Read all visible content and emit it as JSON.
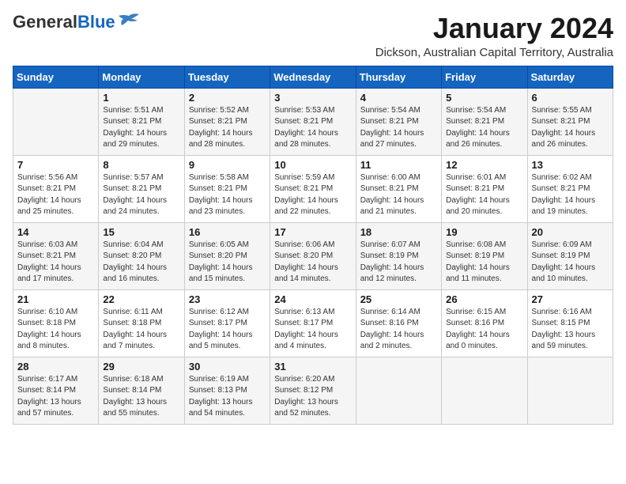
{
  "logo": {
    "general": "General",
    "blue": "Blue"
  },
  "header": {
    "month_year": "January 2024",
    "location": "Dickson, Australian Capital Territory, Australia"
  },
  "weekdays": [
    "Sunday",
    "Monday",
    "Tuesday",
    "Wednesday",
    "Thursday",
    "Friday",
    "Saturday"
  ],
  "weeks": [
    [
      {
        "day": "",
        "sunrise": "",
        "sunset": "",
        "daylight": ""
      },
      {
        "day": "1",
        "sunrise": "Sunrise: 5:51 AM",
        "sunset": "Sunset: 8:21 PM",
        "daylight": "Daylight: 14 hours and 29 minutes."
      },
      {
        "day": "2",
        "sunrise": "Sunrise: 5:52 AM",
        "sunset": "Sunset: 8:21 PM",
        "daylight": "Daylight: 14 hours and 28 minutes."
      },
      {
        "day": "3",
        "sunrise": "Sunrise: 5:53 AM",
        "sunset": "Sunset: 8:21 PM",
        "daylight": "Daylight: 14 hours and 28 minutes."
      },
      {
        "day": "4",
        "sunrise": "Sunrise: 5:54 AM",
        "sunset": "Sunset: 8:21 PM",
        "daylight": "Daylight: 14 hours and 27 minutes."
      },
      {
        "day": "5",
        "sunrise": "Sunrise: 5:54 AM",
        "sunset": "Sunset: 8:21 PM",
        "daylight": "Daylight: 14 hours and 26 minutes."
      },
      {
        "day": "6",
        "sunrise": "Sunrise: 5:55 AM",
        "sunset": "Sunset: 8:21 PM",
        "daylight": "Daylight: 14 hours and 26 minutes."
      }
    ],
    [
      {
        "day": "7",
        "sunrise": "Sunrise: 5:56 AM",
        "sunset": "Sunset: 8:21 PM",
        "daylight": "Daylight: 14 hours and 25 minutes."
      },
      {
        "day": "8",
        "sunrise": "Sunrise: 5:57 AM",
        "sunset": "Sunset: 8:21 PM",
        "daylight": "Daylight: 14 hours and 24 minutes."
      },
      {
        "day": "9",
        "sunrise": "Sunrise: 5:58 AM",
        "sunset": "Sunset: 8:21 PM",
        "daylight": "Daylight: 14 hours and 23 minutes."
      },
      {
        "day": "10",
        "sunrise": "Sunrise: 5:59 AM",
        "sunset": "Sunset: 8:21 PM",
        "daylight": "Daylight: 14 hours and 22 minutes."
      },
      {
        "day": "11",
        "sunrise": "Sunrise: 6:00 AM",
        "sunset": "Sunset: 8:21 PM",
        "daylight": "Daylight: 14 hours and 21 minutes."
      },
      {
        "day": "12",
        "sunrise": "Sunrise: 6:01 AM",
        "sunset": "Sunset: 8:21 PM",
        "daylight": "Daylight: 14 hours and 20 minutes."
      },
      {
        "day": "13",
        "sunrise": "Sunrise: 6:02 AM",
        "sunset": "Sunset: 8:21 PM",
        "daylight": "Daylight: 14 hours and 19 minutes."
      }
    ],
    [
      {
        "day": "14",
        "sunrise": "Sunrise: 6:03 AM",
        "sunset": "Sunset: 8:21 PM",
        "daylight": "Daylight: 14 hours and 17 minutes."
      },
      {
        "day": "15",
        "sunrise": "Sunrise: 6:04 AM",
        "sunset": "Sunset: 8:20 PM",
        "daylight": "Daylight: 14 hours and 16 minutes."
      },
      {
        "day": "16",
        "sunrise": "Sunrise: 6:05 AM",
        "sunset": "Sunset: 8:20 PM",
        "daylight": "Daylight: 14 hours and 15 minutes."
      },
      {
        "day": "17",
        "sunrise": "Sunrise: 6:06 AM",
        "sunset": "Sunset: 8:20 PM",
        "daylight": "Daylight: 14 hours and 14 minutes."
      },
      {
        "day": "18",
        "sunrise": "Sunrise: 6:07 AM",
        "sunset": "Sunset: 8:19 PM",
        "daylight": "Daylight: 14 hours and 12 minutes."
      },
      {
        "day": "19",
        "sunrise": "Sunrise: 6:08 AM",
        "sunset": "Sunset: 8:19 PM",
        "daylight": "Daylight: 14 hours and 11 minutes."
      },
      {
        "day": "20",
        "sunrise": "Sunrise: 6:09 AM",
        "sunset": "Sunset: 8:19 PM",
        "daylight": "Daylight: 14 hours and 10 minutes."
      }
    ],
    [
      {
        "day": "21",
        "sunrise": "Sunrise: 6:10 AM",
        "sunset": "Sunset: 8:18 PM",
        "daylight": "Daylight: 14 hours and 8 minutes."
      },
      {
        "day": "22",
        "sunrise": "Sunrise: 6:11 AM",
        "sunset": "Sunset: 8:18 PM",
        "daylight": "Daylight: 14 hours and 7 minutes."
      },
      {
        "day": "23",
        "sunrise": "Sunrise: 6:12 AM",
        "sunset": "Sunset: 8:17 PM",
        "daylight": "Daylight: 14 hours and 5 minutes."
      },
      {
        "day": "24",
        "sunrise": "Sunrise: 6:13 AM",
        "sunset": "Sunset: 8:17 PM",
        "daylight": "Daylight: 14 hours and 4 minutes."
      },
      {
        "day": "25",
        "sunrise": "Sunrise: 6:14 AM",
        "sunset": "Sunset: 8:16 PM",
        "daylight": "Daylight: 14 hours and 2 minutes."
      },
      {
        "day": "26",
        "sunrise": "Sunrise: 6:15 AM",
        "sunset": "Sunset: 8:16 PM",
        "daylight": "Daylight: 14 hours and 0 minutes."
      },
      {
        "day": "27",
        "sunrise": "Sunrise: 6:16 AM",
        "sunset": "Sunset: 8:15 PM",
        "daylight": "Daylight: 13 hours and 59 minutes."
      }
    ],
    [
      {
        "day": "28",
        "sunrise": "Sunrise: 6:17 AM",
        "sunset": "Sunset: 8:14 PM",
        "daylight": "Daylight: 13 hours and 57 minutes."
      },
      {
        "day": "29",
        "sunrise": "Sunrise: 6:18 AM",
        "sunset": "Sunset: 8:14 PM",
        "daylight": "Daylight: 13 hours and 55 minutes."
      },
      {
        "day": "30",
        "sunrise": "Sunrise: 6:19 AM",
        "sunset": "Sunset: 8:13 PM",
        "daylight": "Daylight: 13 hours and 54 minutes."
      },
      {
        "day": "31",
        "sunrise": "Sunrise: 6:20 AM",
        "sunset": "Sunset: 8:12 PM",
        "daylight": "Daylight: 13 hours and 52 minutes."
      },
      {
        "day": "",
        "sunrise": "",
        "sunset": "",
        "daylight": ""
      },
      {
        "day": "",
        "sunrise": "",
        "sunset": "",
        "daylight": ""
      },
      {
        "day": "",
        "sunrise": "",
        "sunset": "",
        "daylight": ""
      }
    ]
  ]
}
